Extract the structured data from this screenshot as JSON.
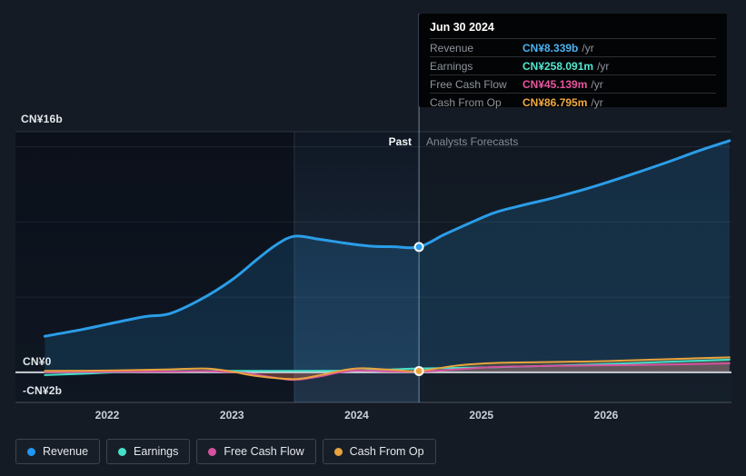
{
  "tooltip": {
    "date": "Jun 30 2024",
    "rows": [
      {
        "label": "Revenue",
        "value": "CN¥8.339b",
        "suffix": "/yr",
        "color": "#4CB2F0"
      },
      {
        "label": "Earnings",
        "value": "CN¥258.091m",
        "suffix": "/yr",
        "color": "#52E8D2"
      },
      {
        "label": "Free Cash Flow",
        "value": "CN¥45.139m",
        "suffix": "/yr",
        "color": "#E8559F"
      },
      {
        "label": "Cash From Op",
        "value": "CN¥86.795m",
        "suffix": "/yr",
        "color": "#F0A942"
      }
    ]
  },
  "sections": {
    "past_label": "Past",
    "forecast_label": "Analysts Forecasts"
  },
  "axis": {
    "y_top_label": "CN¥16b",
    "y_zero_label": "CN¥0",
    "y_bottom_label": "-CN¥2b",
    "years": [
      2022,
      2023,
      2024,
      2025,
      2026
    ]
  },
  "legend": [
    {
      "label": "Revenue",
      "color": "#2196F3"
    },
    {
      "label": "Earnings",
      "color": "#45E0C8"
    },
    {
      "label": "Free Cash Flow",
      "color": "#D6519F"
    },
    {
      "label": "Cash From Op",
      "color": "#E8A33D"
    }
  ],
  "chart_data": {
    "type": "line",
    "title": "Earnings and Revenue Growth — Past and Analysts Forecasts",
    "x_unit": "year (decimal)",
    "x_range": [
      2021.5,
      2027.0
    ],
    "y_unit": "CN¥ billions",
    "y_range": [
      -2,
      16
    ],
    "gridlines_y": [
      16,
      15,
      10,
      5,
      -2
    ],
    "zero_line_y": 0,
    "divider_x": 2024.5,
    "divider_date": "Jun 30 2024",
    "highlight_band_x": [
      2023.5,
      2024.5
    ],
    "legend_position": "bottom-left",
    "series": [
      {
        "name": "Revenue",
        "color": "#2B9DE8",
        "width": 3,
        "fill_opacity": 0.17,
        "past": [
          [
            2021.5,
            2.4
          ],
          [
            2021.8,
            2.85
          ],
          [
            2022.0,
            3.2
          ],
          [
            2022.3,
            3.7
          ],
          [
            2022.5,
            3.9
          ],
          [
            2022.75,
            4.85
          ],
          [
            2023.0,
            6.15
          ],
          [
            2023.2,
            7.5
          ],
          [
            2023.35,
            8.45
          ],
          [
            2023.5,
            9.05
          ],
          [
            2023.7,
            8.85
          ],
          [
            2023.9,
            8.6
          ],
          [
            2024.1,
            8.4
          ],
          [
            2024.3,
            8.35
          ],
          [
            2024.5,
            8.339
          ]
        ],
        "forecast": [
          [
            2024.7,
            9.15
          ],
          [
            2024.9,
            9.9
          ],
          [
            2025.1,
            10.6
          ],
          [
            2025.3,
            11.05
          ],
          [
            2025.6,
            11.65
          ],
          [
            2025.9,
            12.35
          ],
          [
            2026.2,
            13.15
          ],
          [
            2026.5,
            14.0
          ],
          [
            2026.75,
            14.75
          ],
          [
            2026.99,
            15.4
          ]
        ]
      },
      {
        "name": "Earnings",
        "color": "#45E0C8",
        "width": 2,
        "fill_opacity": 0.1,
        "past": [
          [
            2021.5,
            -0.18
          ],
          [
            2021.8,
            -0.1
          ],
          [
            2022.0,
            -0.02
          ],
          [
            2022.3,
            0.05
          ],
          [
            2022.6,
            0.08
          ],
          [
            2023.0,
            0.1
          ],
          [
            2023.5,
            0.1
          ],
          [
            2024.0,
            0.12
          ],
          [
            2024.5,
            0.258
          ]
        ],
        "forecast": [
          [
            2025.0,
            0.32
          ],
          [
            2025.5,
            0.42
          ],
          [
            2026.0,
            0.55
          ],
          [
            2026.5,
            0.7
          ],
          [
            2026.99,
            0.85
          ]
        ]
      },
      {
        "name": "Free Cash Flow",
        "color": "#D6519F",
        "width": 2,
        "fill_opacity": 0.2,
        "past": [
          [
            2021.5,
            0.02
          ],
          [
            2022.0,
            0.03
          ],
          [
            2022.5,
            0.05
          ],
          [
            2022.8,
            0.08
          ],
          [
            2023.1,
            -0.05
          ],
          [
            2023.3,
            -0.3
          ],
          [
            2023.5,
            -0.5
          ],
          [
            2023.7,
            -0.28
          ],
          [
            2023.85,
            -0.02
          ],
          [
            2024.0,
            0.12
          ],
          [
            2024.2,
            0.08
          ],
          [
            2024.5,
            0.045
          ]
        ],
        "forecast": [
          [
            2024.8,
            0.2
          ],
          [
            2025.1,
            0.35
          ],
          [
            2025.5,
            0.42
          ],
          [
            2026.0,
            0.47
          ],
          [
            2026.5,
            0.52
          ],
          [
            2026.99,
            0.6
          ]
        ]
      },
      {
        "name": "Cash From Op",
        "color": "#E8A33D",
        "width": 2,
        "fill_opacity": 0.2,
        "past": [
          [
            2021.5,
            0.1
          ],
          [
            2022.0,
            0.12
          ],
          [
            2022.5,
            0.2
          ],
          [
            2022.8,
            0.25
          ],
          [
            2023.0,
            0.05
          ],
          [
            2023.2,
            -0.25
          ],
          [
            2023.5,
            -0.45
          ],
          [
            2023.7,
            -0.2
          ],
          [
            2023.9,
            0.15
          ],
          [
            2024.05,
            0.27
          ],
          [
            2024.3,
            0.15
          ],
          [
            2024.5,
            0.087
          ]
        ],
        "forecast": [
          [
            2024.8,
            0.45
          ],
          [
            2025.1,
            0.62
          ],
          [
            2025.5,
            0.68
          ],
          [
            2026.0,
            0.75
          ],
          [
            2026.5,
            0.88
          ],
          [
            2026.99,
            1.0
          ]
        ]
      }
    ],
    "markers": [
      {
        "series": "Revenue",
        "x": 2024.5,
        "y": 8.339,
        "color": "#2B9DE8"
      },
      {
        "series": "Cash From Op",
        "x": 2024.5,
        "y": 0.087,
        "color": "#E8A33D"
      }
    ]
  }
}
